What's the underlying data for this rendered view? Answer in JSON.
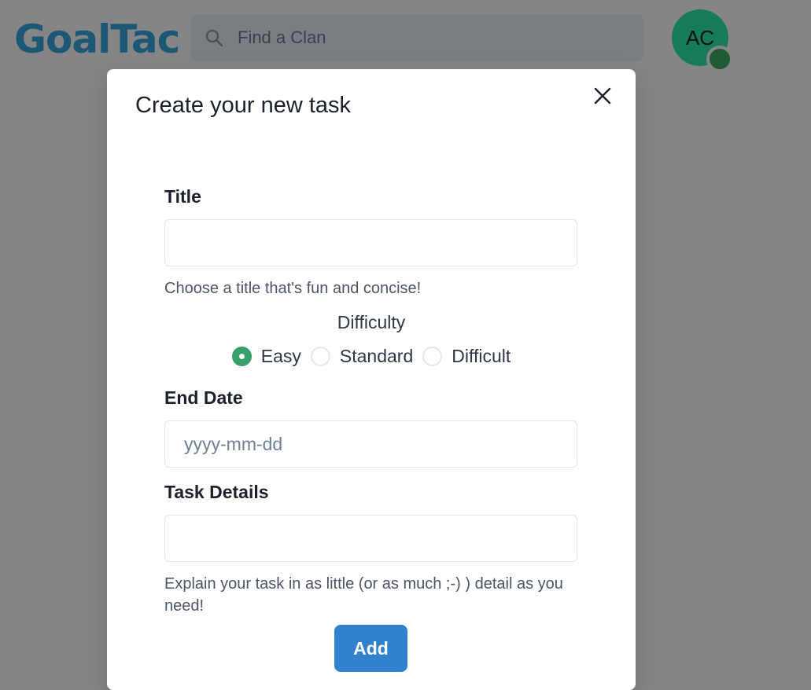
{
  "header": {
    "logo": "GoalTac",
    "search": {
      "placeholder": "Find a Clan",
      "icon": "search-icon"
    },
    "avatar": {
      "initials": "AC",
      "color": "#157b5a"
    }
  },
  "modal": {
    "title": "Create your new task",
    "close_icon": "close-icon",
    "title_field": {
      "label": "Title",
      "value": "",
      "helper": "Choose a title that's fun and concise!"
    },
    "difficulty": {
      "label": "Difficulty",
      "options": [
        "Easy",
        "Standard",
        "Difficult"
      ],
      "selected": "Easy"
    },
    "end_date": {
      "label": "End Date",
      "placeholder": "yyyy-mm-dd",
      "value": ""
    },
    "task_details": {
      "label": "Task Details",
      "value": "",
      "helper": "Explain your task in as little (or as much ;-) ) detail as you need!"
    },
    "add_label": "Add"
  },
  "colors": {
    "accent": "#3182ce",
    "radio_selected": "#38a169",
    "logo": "#1d5776"
  }
}
